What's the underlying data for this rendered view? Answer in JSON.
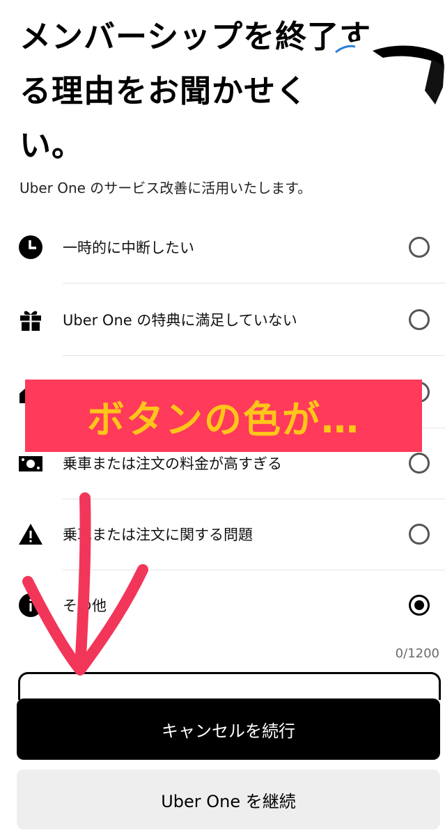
{
  "header": {
    "title": "メンバーシップを終了する理由をお聞かせください。",
    "title_line1": "メンバーシップを終了す",
    "title_line2": "る理由をお聞かせく",
    "title_line3": "い。",
    "subtitle": "Uber One のサービス改善に活用いたします。"
  },
  "reasons": [
    {
      "icon": "clock-icon",
      "label": "一時的に中断したい",
      "selected": false
    },
    {
      "icon": "gift-icon",
      "label": "Uber One の特典に満足していない",
      "selected": false
    },
    {
      "icon": "home-icon",
      "label": "",
      "selected": false
    },
    {
      "icon": "money-icon",
      "label": "乗車または注文の料金が高すぎる",
      "selected": false
    },
    {
      "icon": "warning-icon",
      "label": "乗車または注文に関する問題",
      "selected": false
    },
    {
      "icon": "info-icon",
      "label": "その他",
      "selected": true
    }
  ],
  "feedback": {
    "char_counter": "0/1200"
  },
  "actions": {
    "continue_cancel_label": "キャンセルを続行",
    "keep_membership_label": "Uber One を継続"
  },
  "overlay": {
    "banner_text": "ボタンの色が…",
    "banner_bg": "#ff3a5a",
    "banner_text_color": "#ffc619",
    "arrow_color": "#f2365a"
  }
}
